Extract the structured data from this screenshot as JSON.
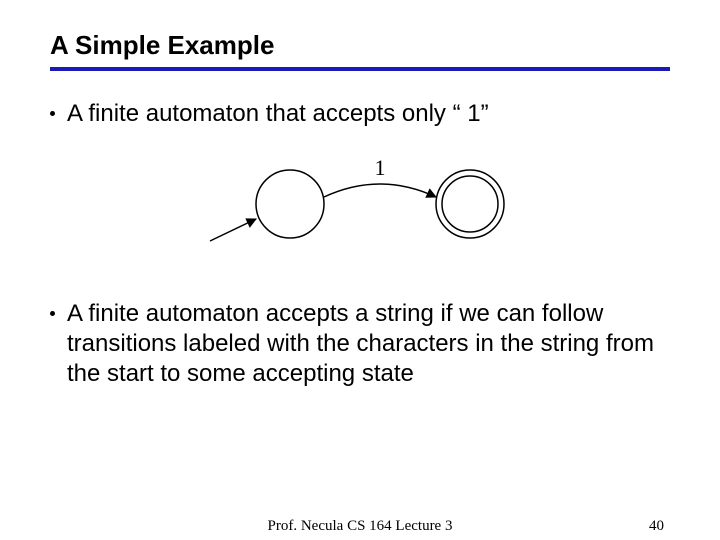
{
  "title": "A Simple Example",
  "bullets": [
    "A finite automaton that accepts only “ 1”",
    "A finite automaton accepts a string if we can follow transitions labeled with the characters in the string from the start to some accepting state"
  ],
  "diagram": {
    "transition_label": "1"
  },
  "footer": {
    "center": "Prof. Necula  CS 164  Lecture 3",
    "page": "40"
  }
}
